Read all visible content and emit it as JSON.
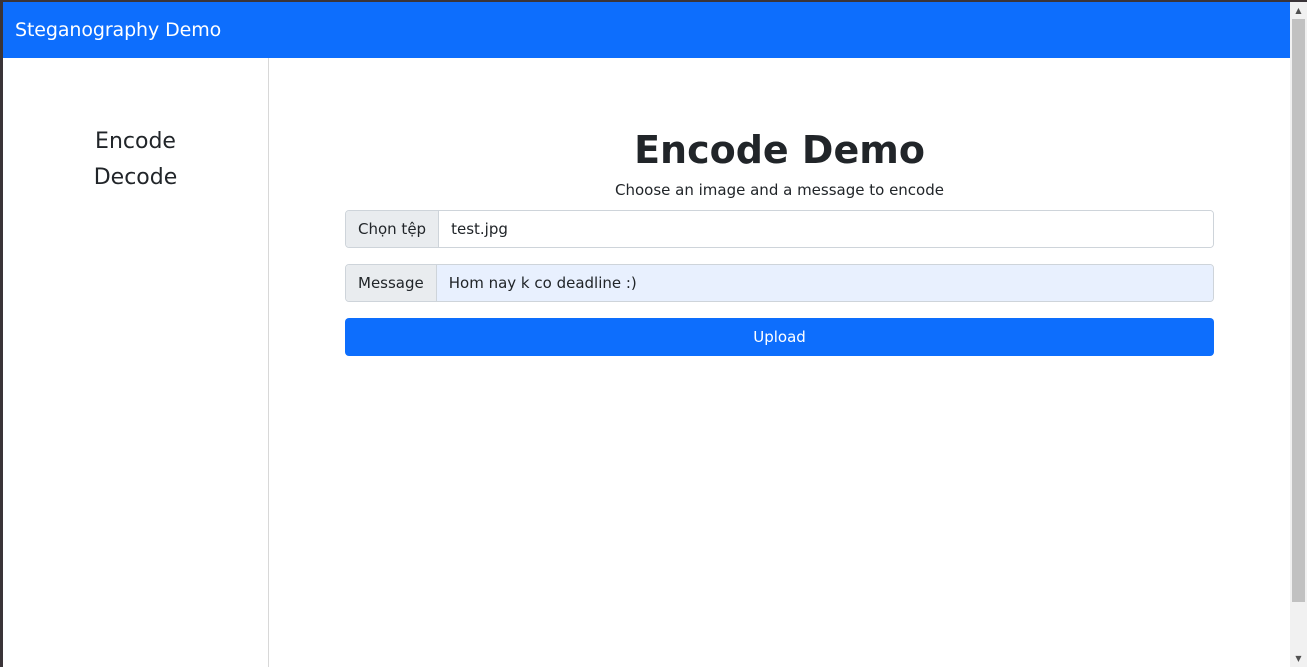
{
  "navbar": {
    "brand": "Steganography Demo"
  },
  "sidebar": {
    "items": [
      {
        "label": "Encode"
      },
      {
        "label": "Decode"
      }
    ]
  },
  "main": {
    "title": "Encode Demo",
    "subtitle": "Choose an image and a message to encode",
    "file_input": {
      "button_label": "Chọn tệp",
      "file_name": "test.jpg"
    },
    "message_input": {
      "label": "Message",
      "value": "Hom nay k co deadline :)"
    },
    "upload_label": "Upload"
  },
  "colors": {
    "primary": "#0d6efd",
    "addon_bg": "#e9ecef",
    "autofill_bg": "#e8f0fe"
  },
  "scrollbar": {
    "up_icon": "▲",
    "down_icon": "▼"
  }
}
